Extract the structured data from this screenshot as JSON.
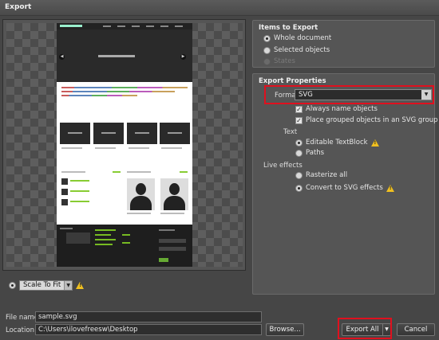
{
  "window": {
    "title": "Export"
  },
  "preview": {
    "scale_option": "Scale To Fit"
  },
  "items_panel": {
    "title": "Items to Export",
    "options": [
      {
        "label": "Whole document",
        "selected": true,
        "enabled": true
      },
      {
        "label": "Selected objects",
        "selected": false,
        "enabled": true
      },
      {
        "label": "States",
        "selected": false,
        "enabled": false
      }
    ]
  },
  "properties_panel": {
    "title": "Export Properties",
    "format_label": "Format",
    "format_value": "SVG",
    "checkboxes": [
      {
        "label": "Always name objects",
        "checked": true
      },
      {
        "label": "Place grouped objects in an SVG group",
        "checked": true
      }
    ],
    "text_section": {
      "label": "Text",
      "options": [
        {
          "label": "Editable TextBlock",
          "selected": true,
          "warning": true
        },
        {
          "label": "Paths",
          "selected": false,
          "warning": false
        }
      ]
    },
    "live_effects_section": {
      "label": "Live effects",
      "options": [
        {
          "label": "Rasterize all",
          "selected": false,
          "warning": false
        },
        {
          "label": "Convert to SVG effects",
          "selected": true,
          "warning": true
        }
      ]
    }
  },
  "footer": {
    "file_name_label": "File name",
    "file_name_value": "sample.svg",
    "location_label": "Location",
    "location_value": "C:\\Users\\ilovefreesw\\Desktop",
    "browse_label": "Browse...",
    "export_all_label": "Export All",
    "cancel_label": "Cancel"
  },
  "colors": {
    "highlight": "#e0101e",
    "background": "#464646",
    "panel": "#555555",
    "warning": "#f0c020"
  }
}
